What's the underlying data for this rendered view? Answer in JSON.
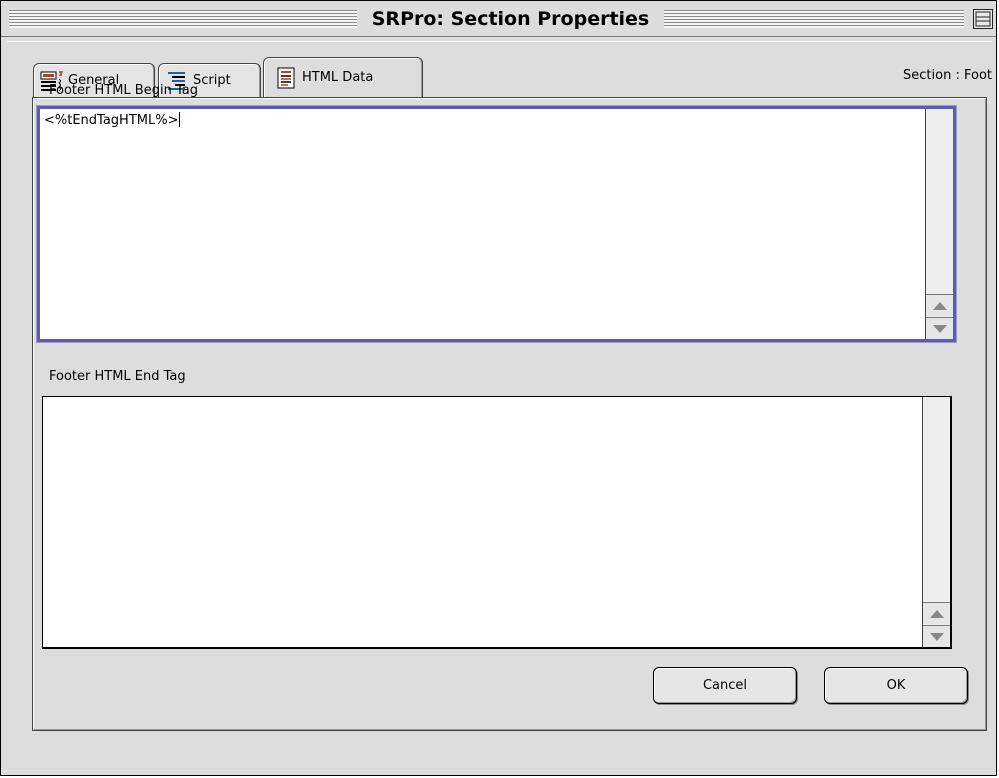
{
  "window": {
    "title": "SRPro: Section Properties"
  },
  "tabs": [
    {
      "label": "General",
      "icon": "general-list-icon",
      "active": false
    },
    {
      "label": "Script",
      "icon": "script-icon",
      "active": false
    },
    {
      "label": "HTML Data",
      "icon": "html-document-icon",
      "active": true
    }
  ],
  "section_indicator": "Section : Foot",
  "fields": {
    "begin": {
      "label": "Footer HTML Begin Tag",
      "value": "<%tEndTagHTML%>"
    },
    "end": {
      "label": "Footer HTML End Tag",
      "value": ""
    }
  },
  "buttons": {
    "cancel": "Cancel",
    "ok": "OK"
  },
  "colors": {
    "focus_border": "#5d5dab",
    "window_bg": "#dddddd"
  }
}
